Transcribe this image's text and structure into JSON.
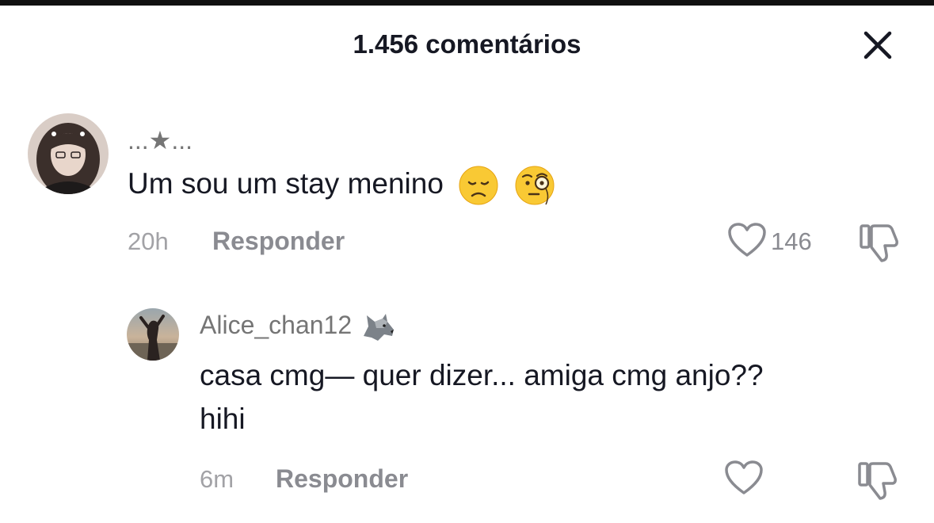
{
  "header": {
    "title": "1.456 comentários"
  },
  "comments": [
    {
      "username": "...★...",
      "text": "Um sou um stay menino",
      "emojis": [
        "disappointed-face",
        "face-with-monocle"
      ],
      "time": "20h",
      "reply_label": "Responder",
      "likes": "146",
      "avatar": "user-avatar-photo"
    }
  ],
  "replies": [
    {
      "username": "Alice_chan12",
      "username_emoji": "wolf-emoji",
      "text_line1": "casa cmg— quer dizer... amiga cmg anjo??",
      "text_line2": "hihi",
      "time": "6m",
      "reply_label": "Responder",
      "likes": "",
      "avatar": "beach-silhouette-avatar"
    }
  ],
  "icons": {
    "close": "close-icon",
    "like": "heart-outline-icon",
    "dislike": "thumbs-down-icon"
  }
}
